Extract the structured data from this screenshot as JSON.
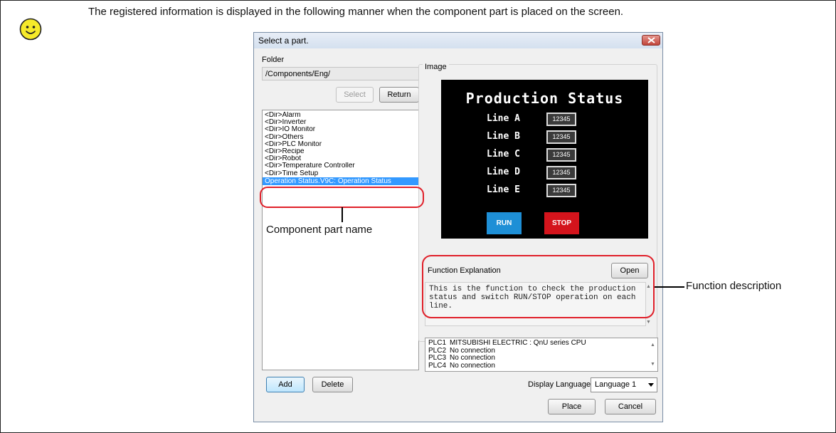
{
  "intro_text": "The registered information is displayed in the following manner when the component part is placed on the screen.",
  "dialog": {
    "title": "Select a part.",
    "folder_label": "Folder",
    "folder_value": "/Components/Eng/",
    "select_button": "Select",
    "return_button": "Return",
    "list_items": [
      "<Dir>Alarm",
      "<Dir>Inverter",
      "<Dir>IO Monitor",
      "<Dir>Others",
      "<Dir>PLC Monitor",
      "<Dir>Recipe",
      "<Dir>Robot",
      "<Dir>Temperature Controller",
      "<Dir>Time Setup",
      "Operation Status.V9C:  Operation Status"
    ],
    "image_label": "Image",
    "preview": {
      "title": "Production Status",
      "lines": [
        {
          "label": "Line A",
          "value": "12345"
        },
        {
          "label": "Line B",
          "value": "12345"
        },
        {
          "label": "Line C",
          "value": "12345"
        },
        {
          "label": "Line D",
          "value": "12345"
        },
        {
          "label": "Line E",
          "value": "12345"
        }
      ],
      "run_label": "RUN",
      "stop_label": "STOP",
      "run_color": "#1e8fd6",
      "stop_color": "#d4141c"
    },
    "function_label": "Function Explanation",
    "open_button": "Open",
    "function_text": "This is the function to check the production status and switch RUN/STOP operation on each line.",
    "plc_rows": [
      {
        "id": "PLC1",
        "value": "MITSUBISHI ELECTRIC : QnU series CPU"
      },
      {
        "id": "PLC2",
        "value": "No connection"
      },
      {
        "id": "PLC3",
        "value": "No connection"
      },
      {
        "id": "PLC4",
        "value": "No connection"
      }
    ],
    "add_button": "Add",
    "delete_button": "Delete",
    "display_language_label": "Display Language",
    "display_language_value": "Language 1",
    "place_button": "Place",
    "cancel_button": "Cancel"
  },
  "callouts": {
    "component_part_name": "Component part name",
    "function_description": "Function description"
  },
  "colors": {
    "highlight": "#e0202a",
    "selection": "#3399ff",
    "smiley": "#f6ea2a"
  }
}
